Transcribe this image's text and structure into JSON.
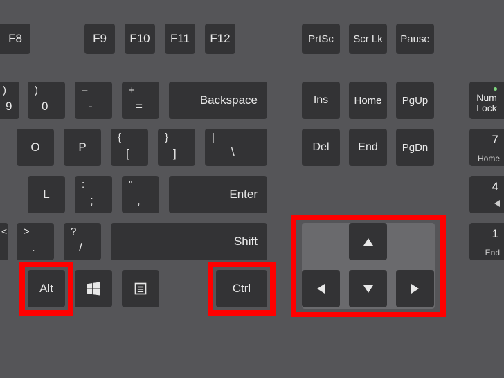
{
  "highlighted_keys": [
    "Alt",
    "Ctrl",
    "ArrowUp",
    "ArrowDown",
    "ArrowLeft",
    "ArrowRight"
  ],
  "rows": {
    "function": {
      "f8": "F8",
      "f9": "F9",
      "f10": "F10",
      "f11": "F11",
      "f12": "F12",
      "prtsc": "PrtSc",
      "scrlk": "Scr Lk",
      "pause": "Pause"
    },
    "num": {
      "k9": {
        "sup": ")",
        "main": "9"
      },
      "k0": {
        "sup": ")",
        "main": "0"
      },
      "minus": {
        "sup": "–",
        "main": "-"
      },
      "equals": {
        "sup": "+",
        "main": "="
      },
      "backspace": "Backspace",
      "ins": "Ins",
      "home": "Home",
      "pgup": "PgUp",
      "numlock": "Num Lock"
    },
    "qwerty": {
      "o": "O",
      "p": "P",
      "lbr": {
        "sup": "{",
        "main": "["
      },
      "rbr": {
        "sup": "}",
        "main": "]"
      },
      "bslash": {
        "sup": "|",
        "main": "\\"
      },
      "del": "Del",
      "end": "End",
      "pgdn": "PgDn",
      "np7": {
        "main": "7",
        "sub": "Home"
      }
    },
    "asdf": {
      "l": "L",
      "semi": {
        "sup": ":",
        "main": ";"
      },
      "quote": {
        "sup": "\"",
        "main": ","
      },
      "enter": "Enter",
      "np4": {
        "main": "4",
        "sub": "◁"
      }
    },
    "zxcv": {
      "lt": "<",
      "dot": {
        "sup": ">",
        "main": "."
      },
      "slash": {
        "sup": "?",
        "main": "/"
      },
      "shift": "Shift",
      "np1": {
        "main": "1",
        "sub": "End"
      }
    },
    "bottom": {
      "alt": "Alt",
      "win": "windows-icon",
      "menu": "menu-icon",
      "ctrl": "Ctrl"
    },
    "arrows": {
      "up": "▲",
      "left": "◄",
      "down": "▼",
      "right": "►"
    }
  }
}
